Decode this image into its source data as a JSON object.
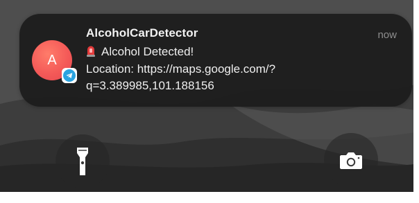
{
  "notification": {
    "app_name": "AlcoholCarDetector",
    "time": "now",
    "avatar_letter": "A",
    "message_line1": "Alcohol Detected!",
    "message_line2": "Location: https://maps.google.com/?",
    "message_line3": "q=3.389985,101.188156",
    "emoji_icon": "police-siren-icon",
    "app_badge_icon": "telegram-icon"
  },
  "lockscreen": {
    "flashlight_icon": "flashlight-icon",
    "camera_icon": "camera-icon"
  },
  "colors": {
    "avatar": "#f45a58",
    "badge": "#2aa3e0",
    "notification_bg": "#1c1c1c"
  }
}
